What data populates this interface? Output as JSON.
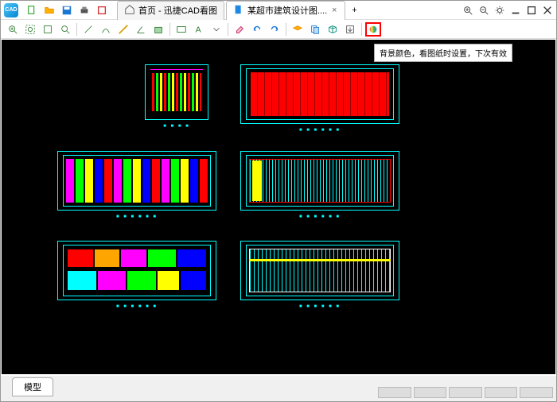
{
  "tabs": {
    "home": "首页 - 迅捷CAD看图",
    "file": "某超市建筑设计图....",
    "new": "+"
  },
  "tooltip": "背景颜色，看图纸时设置，下次有效",
  "status": {
    "model": "模型"
  },
  "plans": {
    "p1": "■ ■ ■ ■",
    "p2": "■ ■ ■ ■ ■ ■",
    "p3": "■ ■ ■ ■ ■ ■",
    "p4": "■ ■ ■ ■ ■ ■",
    "p5": "■ ■ ■ ■ ■ ■",
    "p6": "■ ■ ■ ■ ■ ■"
  }
}
